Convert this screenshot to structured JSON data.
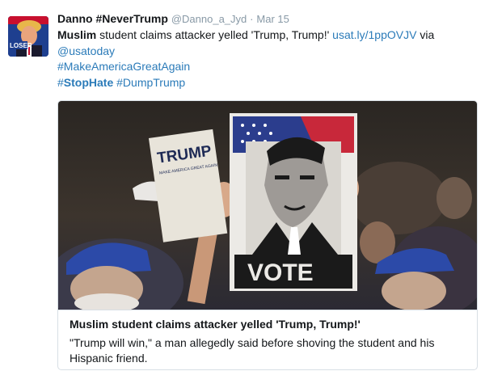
{
  "tweet": {
    "display_name": "Danno #NeverTrump",
    "handle": "@Danno_a_Jyd",
    "separator": "·",
    "timestamp": "Mar 15",
    "avatar_badge": "LOSER",
    "text": {
      "bold_word": "Muslim",
      "line1_rest": " student claims attacker yelled 'Trump, Trump!' ",
      "link": "usat.ly/1ppOVJV",
      "via": " via",
      "mention": "@usatoday",
      "hashtag1": "#MakeAmericaGreatAgain",
      "hashtag2_prefix": "#",
      "hashtag2_bold": "StopHate",
      "hashtag3": "#DumpTrump"
    }
  },
  "card": {
    "image_sign_trump": "TRUMP",
    "image_sign_slogan": "MAKE AMERICA GREAT AGAIN",
    "image_poster_vote": "VOTE",
    "title": "Muslim student claims attacker yelled 'Trump, Trump!'",
    "description_line1": "\"Trump will win,\" a man allegedly said before shoving the student and his",
    "description_line2": "Hispanic friend."
  },
  "colors": {
    "link": "#2b7bb9",
    "muted": "#8899a6",
    "text": "#14171a",
    "border": "#d8dfe5"
  }
}
